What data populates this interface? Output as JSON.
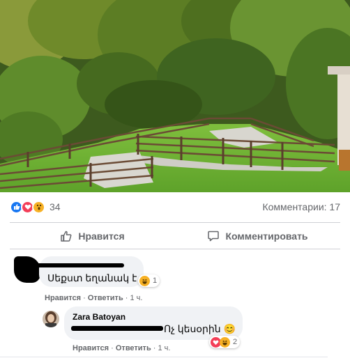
{
  "post": {
    "reactions": {
      "icons": [
        "like-icon",
        "love-icon",
        "wow-icon"
      ],
      "count": "34"
    },
    "comments_count": "Комментарии: 17",
    "actions": {
      "like_label": "Нравится",
      "comment_label": "Комментировать"
    }
  },
  "comments": [
    {
      "text": "Սեքստ եղանակ է",
      "reaction_count": "1",
      "reaction_icons": [
        "haha-icon"
      ],
      "meta": {
        "like": "Нравится",
        "reply": "Ответить",
        "time": "1 ч."
      }
    }
  ],
  "reply": {
    "author": "Zara Batoyan",
    "text": "Ոչ կեսօրին",
    "emoji": "😊",
    "reaction_count": "2",
    "reaction_icons": [
      "love-icon",
      "haha-icon"
    ],
    "meta": {
      "like": "Нравится",
      "reply": "Ответить",
      "time": "1 ч."
    }
  },
  "colors": {
    "like": "#1877f2",
    "love": "#f33e58",
    "wow": "#f7b125",
    "bubble": "#f0f2f5",
    "muted_text": "#65676b"
  }
}
